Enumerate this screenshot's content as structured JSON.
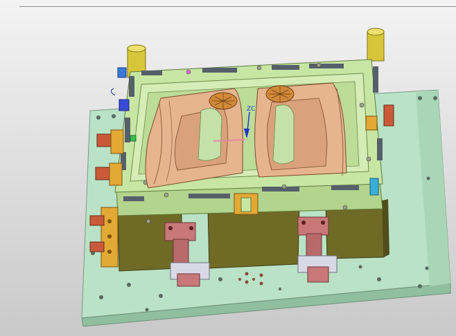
{
  "viewport": {
    "background_top": "#f3f3f3",
    "background_bottom": "#c9c9c9"
  },
  "colors": {
    "base_plate": "#b9e2c6",
    "cavity_plate": "#c8e6a3",
    "part_surface": "#e6b48f",
    "support_block": "#6f6a26",
    "cylinder": "#c9787a",
    "guide_pillar": "#d8c63a",
    "fitting": "#e3a935",
    "vent_grille": "#d08a3a",
    "csys_axis": "#2233cc"
  },
  "csys": {
    "label": "ZC",
    "icon": "wcs-triad-icon"
  }
}
